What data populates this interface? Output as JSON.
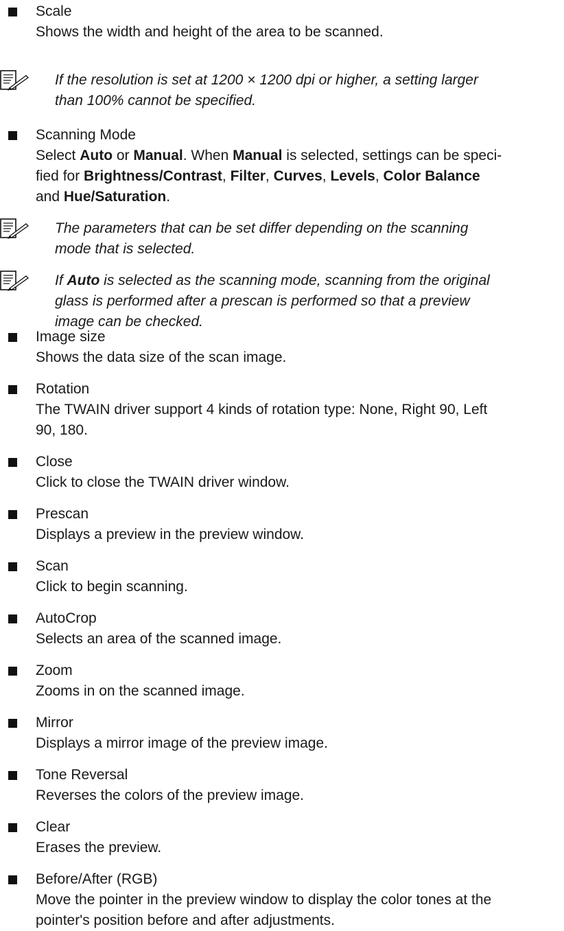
{
  "items": [
    {
      "term": "Scale",
      "desc": "Shows the width and height of the area to be scanned."
    },
    {
      "term": "Scanning Mode",
      "desc_line1_pre": "Select ",
      "desc_auto": "Auto",
      "desc_or": " or ",
      "desc_manual": "Manual",
      "desc_line1_post": ". When ",
      "desc_manual2": "Manual",
      "desc_line1_end": " is selected, settings can be speci-",
      "desc_line2_pre": "fied for ",
      "desc_bc": "Brightness/Contrast",
      "desc_c1": ", ",
      "desc_filter": "Filter",
      "desc_c2": ", ",
      "desc_curves": "Curves",
      "desc_c3": ", ",
      "desc_levels": "Levels",
      "desc_c4": ", ",
      "desc_colorbalance": "Color Balance",
      "desc_and": "and ",
      "desc_huesat": "Hue/Saturation",
      "desc_end": "."
    },
    {
      "term": "Image size",
      "desc": "Shows the data size of the scan image."
    },
    {
      "term": "Rotation",
      "desc_line1": "The TWAIN driver support 4 kinds of rotation type: None, Right 90, Left",
      "desc_line2": "90, 180."
    },
    {
      "term": "Close",
      "desc": "Click to close the TWAIN driver window."
    },
    {
      "term": "Prescan",
      "desc": "Displays a preview in the preview window."
    },
    {
      "term": "Scan",
      "desc": "Click to begin scanning."
    },
    {
      "term": "AutoCrop",
      "desc": "Selects an area of the scanned image."
    },
    {
      "term": "Zoom",
      "desc": "Zooms in on the scanned image."
    },
    {
      "term": "Mirror",
      "desc": "Displays a mirror image of the preview image."
    },
    {
      "term": "Tone Reversal",
      "desc": "Reverses the colors of the preview image."
    },
    {
      "term": "Clear",
      "desc": "Erases the preview."
    },
    {
      "term": "Before/After (RGB)",
      "desc_line1": "Move the pointer in the preview window to display the color tones at the",
      "desc_line2": "pointer's position before and after adjustments."
    }
  ],
  "notes": [
    {
      "line1": "If the resolution is set at 1200 × 1200 dpi or higher, a setting larger",
      "line2": "than 100% cannot be specified."
    },
    {
      "line1": "The parameters that can be set differ depending on the scanning",
      "line2": "mode that is selected."
    },
    {
      "line1_pre": "If ",
      "line1_bold": "Auto",
      "line1_post": " is selected as the scanning mode, scanning from the original",
      "line2": "glass is performed after a prescan is performed so that a preview",
      "line3": "image can be checked."
    }
  ],
  "icon": "note-pencil-icon",
  "colors": {
    "text": "#1a1a1a",
    "bullet": "#111111"
  }
}
